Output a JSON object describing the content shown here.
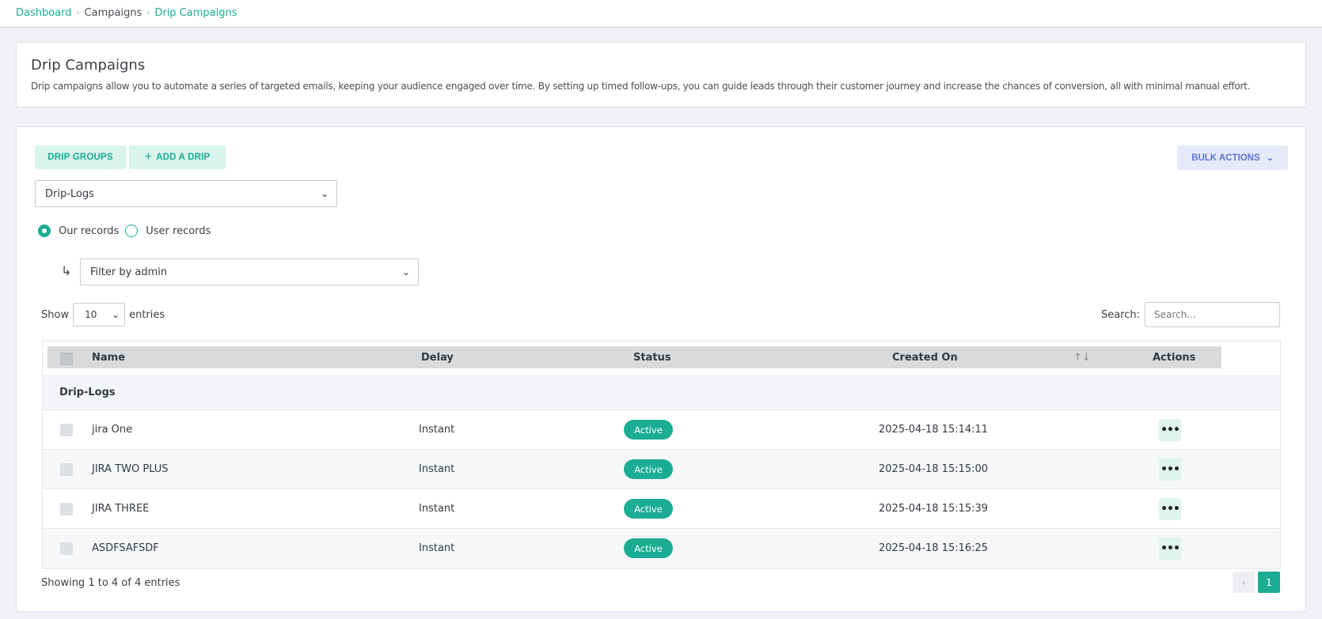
{
  "breadcrumb": {
    "dashboard": "Dashboard",
    "campaigns": "Campaigns",
    "current": "Drip Campaigns"
  },
  "intro": {
    "title": "Drip Campaigns",
    "description": "Drip campaigns allow you to automate a series of targeted emails, keeping your audience engaged over time. By setting up timed follow-ups, you can guide leads through their customer journey and increase the chances of conversion, all with minimal manual effort."
  },
  "toolbar": {
    "drip_groups": "DRIP GROUPS",
    "add_drip": "ADD A DRIP",
    "bulk_actions": "BULK ACTIONS"
  },
  "group_select": {
    "value": "Drip-Logs"
  },
  "records": {
    "our": "Our records",
    "user": "User records",
    "selected": "our"
  },
  "admin_filter": {
    "value": "Filter by admin"
  },
  "length": {
    "show": "Show",
    "value": "10",
    "entries": "entries"
  },
  "search": {
    "label": "Search:",
    "placeholder": "Search..."
  },
  "table": {
    "headers": {
      "name": "Name",
      "delay": "Delay",
      "status": "Status",
      "created": "Created On",
      "actions": "Actions"
    },
    "group_label": "Drip-Logs",
    "rows": [
      {
        "name": "jira One",
        "delay": "Instant",
        "status": "Active",
        "created": "2025-04-18 15:14:11"
      },
      {
        "name": "JIRA TWO PLUS",
        "delay": "Instant",
        "status": "Active",
        "created": "2025-04-18 15:15:00"
      },
      {
        "name": "JIRA THREE",
        "delay": "Instant",
        "status": "Active",
        "created": "2025-04-18 15:15:39"
      },
      {
        "name": "ASDFSAFSDF",
        "delay": "Instant",
        "status": "Active",
        "created": "2025-04-18 15:16:25"
      }
    ]
  },
  "footer": {
    "info": "Showing 1 to 4 of 4 entries",
    "prev": "‹",
    "page": "1"
  },
  "icons": {
    "more": "more-horizontal-icon",
    "sort": "sort-icon",
    "plus": "plus-icon",
    "chevron": "chevron-down-icon",
    "arrow": "return-arrow-icon"
  },
  "colors": {
    "accent": "#1aad93",
    "soft_accent": "#d8f4ec",
    "bulk_bg": "#e6e9f8",
    "bulk_text": "#5b73d8"
  }
}
